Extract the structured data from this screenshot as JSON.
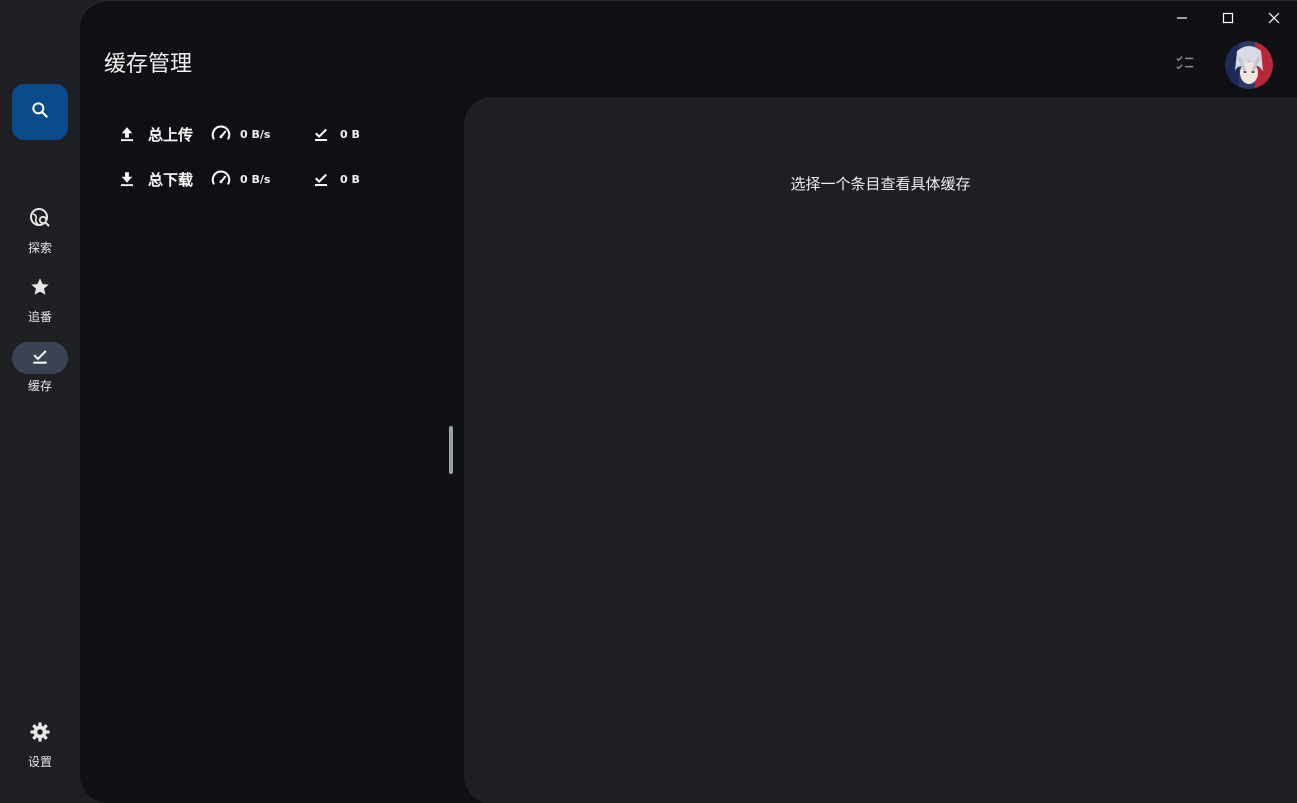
{
  "nav": {
    "search_icon": "search-icon",
    "items": [
      {
        "label": "探索",
        "icon": "explore-search-icon"
      },
      {
        "label": "追番",
        "icon": "star-icon"
      },
      {
        "label": "缓存",
        "icon": "download-done-icon",
        "active": true
      },
      {
        "label": "设置",
        "icon": "gear-icon"
      }
    ]
  },
  "header": {
    "title": "缓存管理"
  },
  "stats": {
    "upload": {
      "label": "总上传",
      "speed": "0 B/s",
      "total": "0 B"
    },
    "download": {
      "label": "总下载",
      "speed": "0 B/s",
      "total": "0 B"
    }
  },
  "detail": {
    "empty_text": "选择一个条目查看具体缓存"
  },
  "colors": {
    "rail_bg": "#1d1f23",
    "main_bg": "#0e1014",
    "accent": "#0b4a8a",
    "active_pill": "#3b4253"
  }
}
